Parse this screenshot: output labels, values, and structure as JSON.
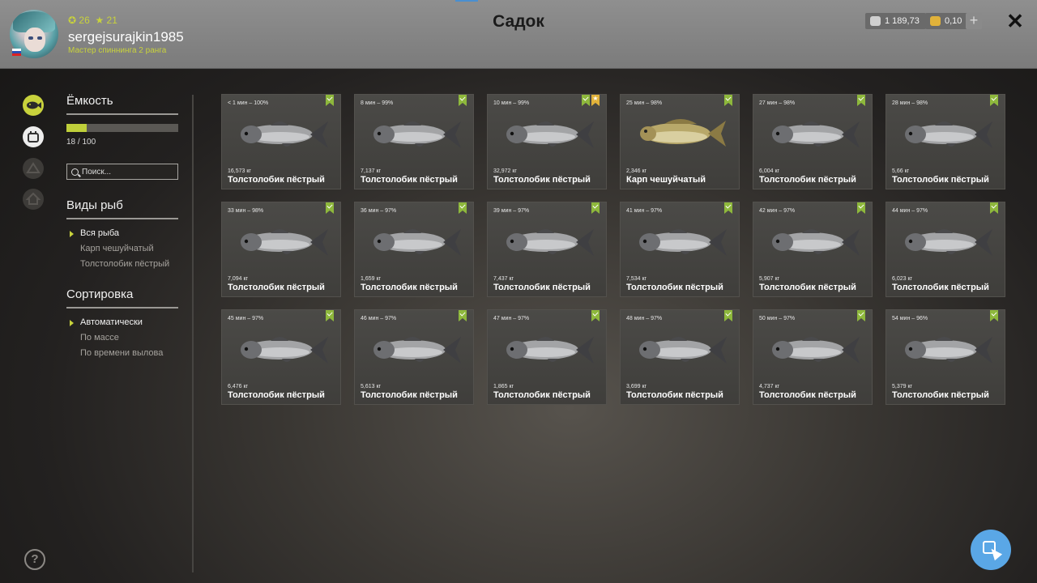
{
  "header": {
    "title": "Садок",
    "username": "sergejsurajkin1985",
    "rank": "Мастер спиннинга 2 ранга",
    "level": "26",
    "stars": "21",
    "silver": "1 189,73",
    "gold": "0,10",
    "plus_label": "+",
    "close_label": "✕"
  },
  "colors": {
    "accent": "#c8d23c",
    "badge_green": "#8eb83c",
    "badge_gold": "#e1b23a",
    "fab": "#5aa7e6"
  },
  "sidebar": {
    "capacity_title": "Ёмкость",
    "capacity_value": "18 / 100",
    "capacity_fraction": 0.18,
    "search_placeholder": "Поиск...",
    "species_title": "Виды рыб",
    "species": [
      "Вся рыба",
      "Карп чешуйчатый",
      "Толстолобик пёстрый"
    ],
    "sort_title": "Сортировка",
    "sort": [
      "Автоматически",
      "По массе",
      "По времени вылова"
    ],
    "help_label": "?"
  },
  "fish": [
    {
      "time": "< 1 мин – 100%",
      "weight": "16,573 кг",
      "name": "Толстолобик пёстрый",
      "kind": "bighead",
      "star": false
    },
    {
      "time": "8 мин – 99%",
      "weight": "7,137 кг",
      "name": "Толстолобик пёстрый",
      "kind": "bighead",
      "star": false
    },
    {
      "time": "10 мин – 99%",
      "weight": "32,972 кг",
      "name": "Толстолобик пёстрый",
      "kind": "bighead",
      "star": true
    },
    {
      "time": "25 мин – 98%",
      "weight": "2,346 кг",
      "name": "Карп чешуйчатый",
      "kind": "carp",
      "star": false
    },
    {
      "time": "27 мин – 98%",
      "weight": "6,004 кг",
      "name": "Толстолобик пёстрый",
      "kind": "bighead",
      "star": false
    },
    {
      "time": "28 мин – 98%",
      "weight": "5,66 кг",
      "name": "Толстолобик пёстрый",
      "kind": "bighead",
      "star": false
    },
    {
      "time": "33 мин – 98%",
      "weight": "7,094 кг",
      "name": "Толстолобик пёстрый",
      "kind": "bighead",
      "star": false
    },
    {
      "time": "36 мин – 97%",
      "weight": "1,659 кг",
      "name": "Толстолобик пёстрый",
      "kind": "bighead",
      "star": false
    },
    {
      "time": "39 мин – 97%",
      "weight": "7,437 кг",
      "name": "Толстолобик пёстрый",
      "kind": "bighead",
      "star": false
    },
    {
      "time": "41 мин – 97%",
      "weight": "7,534 кг",
      "name": "Толстолобик пёстрый",
      "kind": "bighead",
      "star": false
    },
    {
      "time": "42 мин – 97%",
      "weight": "5,907 кг",
      "name": "Толстолобик пёстрый",
      "kind": "bighead",
      "star": false
    },
    {
      "time": "44 мин – 97%",
      "weight": "6,023 кг",
      "name": "Толстолобик пёстрый",
      "kind": "bighead",
      "star": false
    },
    {
      "time": "45 мин – 97%",
      "weight": "6,476 кг",
      "name": "Толстолобик пёстрый",
      "kind": "bighead",
      "star": false
    },
    {
      "time": "46 мин – 97%",
      "weight": "5,613 кг",
      "name": "Толстолобик пёстрый",
      "kind": "bighead",
      "star": false
    },
    {
      "time": "47 мин – 97%",
      "weight": "1,865 кг",
      "name": "Толстолобик пёстрый",
      "kind": "bighead",
      "star": false
    },
    {
      "time": "48 мин – 97%",
      "weight": "3,699 кг",
      "name": "Толстолобик пёстрый",
      "kind": "bighead",
      "star": false
    },
    {
      "time": "50 мин – 97%",
      "weight": "4,737 кг",
      "name": "Толстолобик пёстрый",
      "kind": "bighead",
      "star": false
    },
    {
      "time": "54 мин – 96%",
      "weight": "5,379 кг",
      "name": "Толстолобик пёстрый",
      "kind": "bighead",
      "star": false
    }
  ]
}
